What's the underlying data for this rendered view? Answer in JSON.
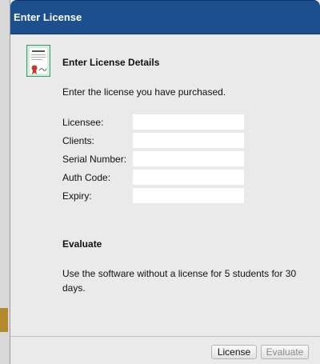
{
  "window": {
    "title": "Enter License"
  },
  "license_section": {
    "title": "Enter License Details",
    "description": "Enter the license you have purchased.",
    "fields": [
      {
        "label": "Licensee:",
        "value": ""
      },
      {
        "label": "Clients:",
        "value": ""
      },
      {
        "label": "Serial Number:",
        "value": ""
      },
      {
        "label": "Auth Code:",
        "value": ""
      },
      {
        "label": "Expiry:",
        "value": ""
      }
    ]
  },
  "evaluate_section": {
    "title": "Evaluate",
    "description_line1": "Use the software without a license for 5 students for 30",
    "description_line2": "days."
  },
  "buttons": {
    "license": "License",
    "evaluate": "Evaluate"
  },
  "colors": {
    "titlebar": "#1c4f8d",
    "dialog_bg": "#eaeaea"
  },
  "icons": {
    "certificate": "certificate-icon"
  }
}
